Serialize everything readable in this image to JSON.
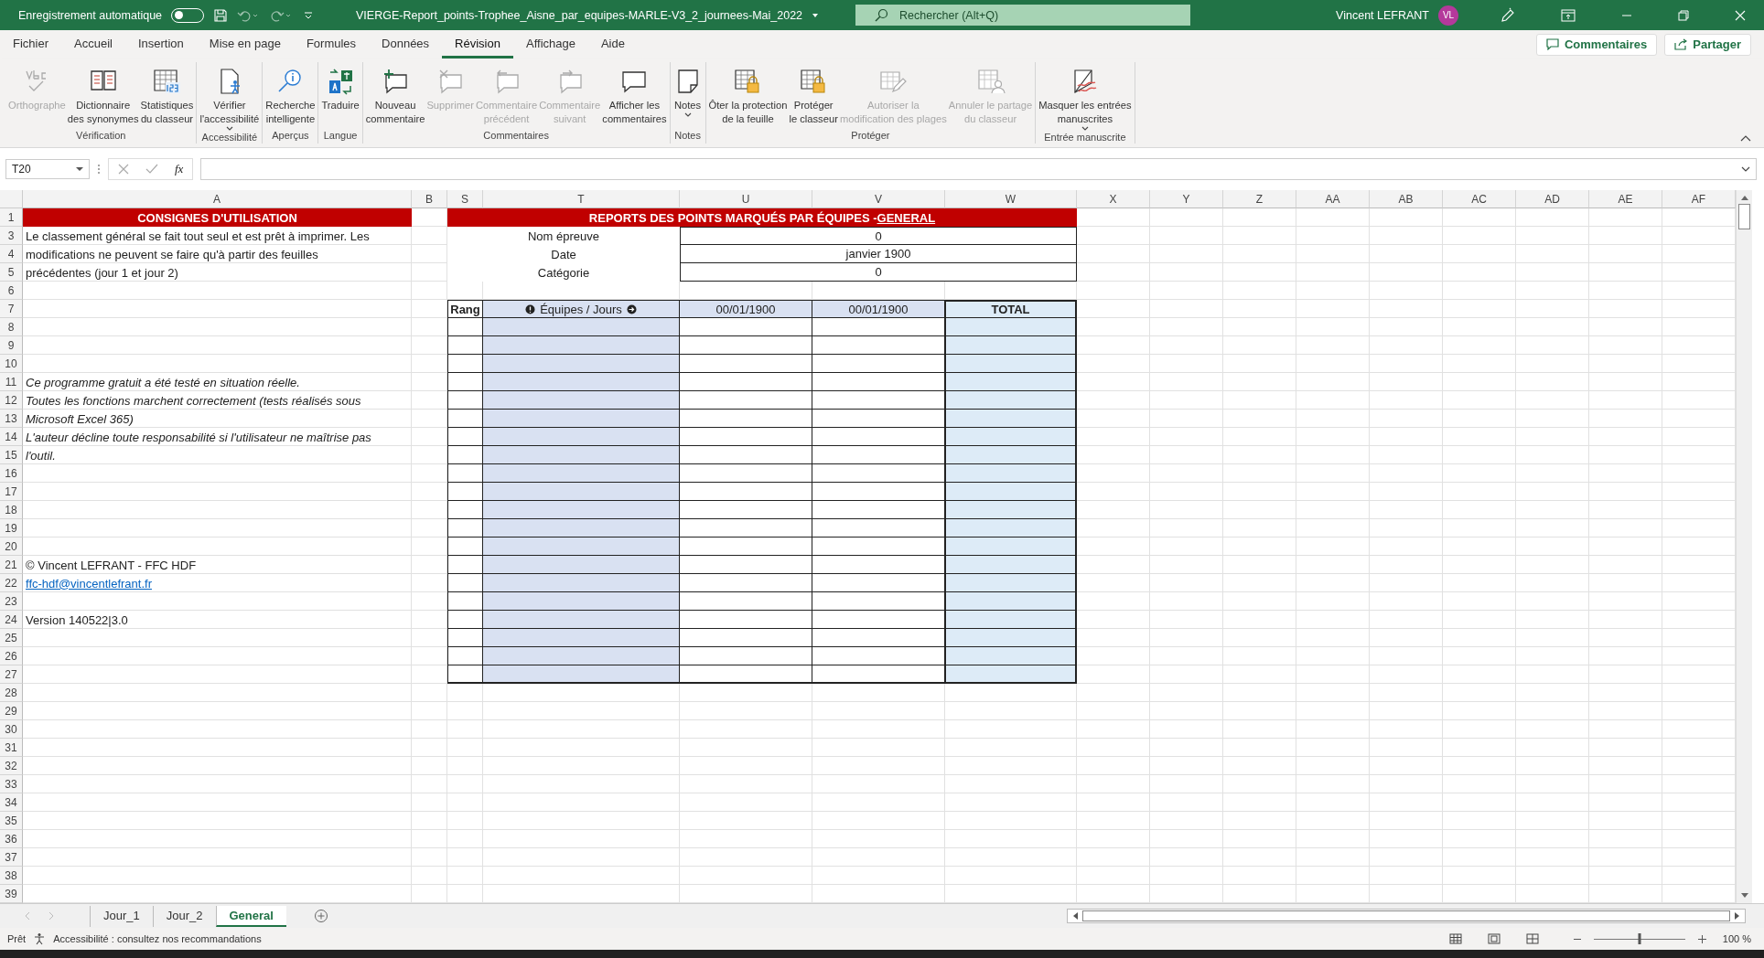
{
  "title_bar": {
    "autosave_label": "Enregistrement automatique",
    "autosave_on": false,
    "title": "VIERGE-Report_points-Trophee_Aisne_par_equipes-MARLE-V3_2_journees-Mai_2022",
    "search": {
      "placeholder": "Rechercher (Alt+Q)"
    },
    "user": "Vincent LEFRANT",
    "avatar": "VL"
  },
  "ribbon_tabs": [
    {
      "label": "Fichier",
      "selected": false
    },
    {
      "label": "Accueil",
      "selected": false
    },
    {
      "label": "Insertion",
      "selected": false
    },
    {
      "label": "Mise en page",
      "selected": false
    },
    {
      "label": "Formules",
      "selected": false
    },
    {
      "label": "Données",
      "selected": false
    },
    {
      "label": "Révision",
      "selected": true
    },
    {
      "label": "Affichage",
      "selected": false
    },
    {
      "label": "Aide",
      "selected": false
    }
  ],
  "ribbon_actions": [
    "Commentaires",
    "Partager"
  ],
  "ribbon_groups": [
    {
      "name": "Vérification",
      "buttons": [
        {
          "kind": "spell",
          "lines": [
            "Orthographe"
          ],
          "disabled": true,
          "dropdown": false
        },
        {
          "kind": "book",
          "lines": [
            "Dictionnaire",
            "des synonymes"
          ],
          "disabled": false,
          "dropdown": false
        },
        {
          "kind": "stats",
          "lines": [
            "Statistiques",
            "du classeur"
          ],
          "disabled": false,
          "dropdown": false
        }
      ]
    },
    {
      "name": "Accessibilité",
      "buttons": [
        {
          "kind": "access",
          "lines": [
            "Vérifier",
            "l'accessibilité"
          ],
          "disabled": false,
          "dropdown": true
        }
      ]
    },
    {
      "name": "Aperçus",
      "buttons": [
        {
          "kind": "insight",
          "lines": [
            "Recherche",
            "intelligente"
          ],
          "disabled": false,
          "dropdown": false
        }
      ]
    },
    {
      "name": "Langue",
      "buttons": [
        {
          "kind": "translate",
          "lines": [
            "Traduire"
          ],
          "disabled": false,
          "dropdown": false
        }
      ]
    },
    {
      "name": "Commentaires",
      "buttons": [
        {
          "kind": "comment-new",
          "lines": [
            "Nouveau",
            "commentaire"
          ],
          "disabled": false,
          "dropdown": false
        },
        {
          "kind": "comment-delete",
          "lines": [
            "Supprimer"
          ],
          "disabled": true,
          "dropdown": false
        },
        {
          "kind": "comment-prev",
          "lines": [
            "Commentaire",
            "précédent"
          ],
          "disabled": true,
          "dropdown": false
        },
        {
          "kind": "comment-next",
          "lines": [
            "Commentaire",
            "suivant"
          ],
          "disabled": true,
          "dropdown": false
        },
        {
          "kind": "comment",
          "lines": [
            "Afficher les",
            "commentaires"
          ],
          "disabled": false,
          "dropdown": false
        }
      ]
    },
    {
      "name": "Notes",
      "buttons": [
        {
          "kind": "note",
          "lines": [
            "Notes"
          ],
          "disabled": false,
          "dropdown": true
        }
      ]
    },
    {
      "name": "Protéger",
      "buttons": [
        {
          "kind": "sheet-lock",
          "lines": [
            "Ôter la protection",
            "de la feuille"
          ],
          "disabled": false,
          "dropdown": false
        },
        {
          "kind": "book-lock",
          "lines": [
            "Protéger",
            "le classeur"
          ],
          "disabled": false,
          "dropdown": false
        },
        {
          "kind": "grid-pen",
          "lines": [
            "Autoriser la",
            "modification des plages"
          ],
          "disabled": true,
          "dropdown": false
        },
        {
          "kind": "grid-person",
          "lines": [
            "Annuler le partage",
            "du classeur"
          ],
          "disabled": true,
          "dropdown": false
        }
      ]
    },
    {
      "name": "Entrée manuscrite",
      "buttons": [
        {
          "kind": "ink",
          "lines": [
            "Masquer les entrées",
            "manuscrites"
          ],
          "disabled": false,
          "dropdown": true
        }
      ]
    }
  ],
  "formula_bar": {
    "name_box": "T20",
    "function_label": "fx"
  },
  "sheet": {
    "columns": [
      "A",
      "B",
      "S",
      "T",
      "U",
      "V",
      "W",
      "X",
      "Y",
      "Z",
      "AA",
      "AB",
      "AC",
      "AD",
      "AE",
      "AF"
    ],
    "rows": [
      {
        "number": "1",
        "kind": "titles",
        "left": "CONSIGNES D'UTILISATION",
        "right": "REPORTS DES POINTS MARQUÉS PAR ÉQUIPES - ",
        "right_link": "GENERAL"
      },
      {
        "number": "3",
        "kind": "info",
        "note": {
          "text": "Le classement général se fait tout seul et est prêt à imprimer. Les",
          "kind": "plain"
        },
        "label": "Nom épreuve",
        "value": "0"
      },
      {
        "number": "4",
        "kind": "info",
        "note": {
          "text": "modifications ne peuvent se faire qu'à partir des feuilles",
          "kind": "plain"
        },
        "label": "Date",
        "value": "janvier 1900"
      },
      {
        "number": "5",
        "kind": "info",
        "note": {
          "text": "précédentes (jour 1 et jour 2)",
          "kind": "plain"
        },
        "label": "Catégorie",
        "value": "0"
      },
      {
        "number": "6",
        "kind": "blank"
      },
      {
        "number": "7",
        "kind": "header",
        "headers": [
          "Rang",
          "Équipes  / Jours",
          "00/01/1900",
          "00/01/1900",
          "TOTAL"
        ]
      },
      {
        "number": "8",
        "kind": "entry"
      },
      {
        "number": "9",
        "kind": "entry"
      },
      {
        "number": "10",
        "kind": "entry"
      },
      {
        "number": "11",
        "kind": "entry",
        "note": {
          "text": "Ce programme gratuit a été testé en situation réelle.",
          "kind": "italic"
        }
      },
      {
        "number": "12",
        "kind": "entry",
        "note": {
          "text": "Toutes les fonctions marchent correctement (tests réalisés sous",
          "kind": "italic"
        }
      },
      {
        "number": "13",
        "kind": "entry",
        "note": {
          "text": "Microsoft Excel 365)",
          "kind": "italic"
        }
      },
      {
        "number": "14",
        "kind": "entry",
        "note": {
          "text": "L'auteur décline toute responsabilité si l'utilisateur ne maîtrise pas",
          "kind": "italic"
        }
      },
      {
        "number": "15",
        "kind": "entry",
        "note": {
          "text": "l'outil.",
          "kind": "italic"
        }
      },
      {
        "number": "16",
        "kind": "entry"
      },
      {
        "number": "17",
        "kind": "entry"
      },
      {
        "number": "18",
        "kind": "entry"
      },
      {
        "number": "19",
        "kind": "entry"
      },
      {
        "number": "20",
        "kind": "entry"
      },
      {
        "number": "21",
        "kind": "entry",
        "note": {
          "text": "© Vincent LEFRANT - FFC HDF",
          "kind": "plain"
        }
      },
      {
        "number": "22",
        "kind": "entry",
        "note": {
          "text": "ffc-hdf@vincentlefrant.fr",
          "kind": "link"
        }
      },
      {
        "number": "23",
        "kind": "entry"
      },
      {
        "number": "24",
        "kind": "entry",
        "note": {
          "text": "Version 140522|3.0",
          "kind": "plain"
        }
      },
      {
        "number": "25",
        "kind": "entry"
      },
      {
        "number": "26",
        "kind": "entry"
      },
      {
        "number": "27",
        "kind": "entry"
      },
      {
        "number": "28",
        "kind": "blank"
      },
      {
        "number": "29",
        "kind": "blank"
      },
      {
        "number": "30",
        "kind": "blank"
      },
      {
        "number": "31",
        "kind": "blank"
      },
      {
        "number": "32",
        "kind": "blank"
      },
      {
        "number": "33",
        "kind": "blank"
      },
      {
        "number": "34",
        "kind": "blank"
      },
      {
        "number": "35",
        "kind": "blank"
      },
      {
        "number": "36",
        "kind": "blank"
      },
      {
        "number": "37",
        "kind": "blank"
      },
      {
        "number": "38",
        "kind": "blank"
      },
      {
        "number": "39",
        "kind": "blank"
      }
    ]
  },
  "sheet_tabs": [
    {
      "label": "Jour_1",
      "selected": false
    },
    {
      "label": "Jour_2",
      "selected": false
    },
    {
      "label": "General",
      "selected": true
    }
  ],
  "status_bar": {
    "mode": "Prêt",
    "accessibility": "Accessibilité : consultez nos recommandations",
    "zoom": {
      "level": 0.5,
      "reading": "100 %"
    }
  }
}
